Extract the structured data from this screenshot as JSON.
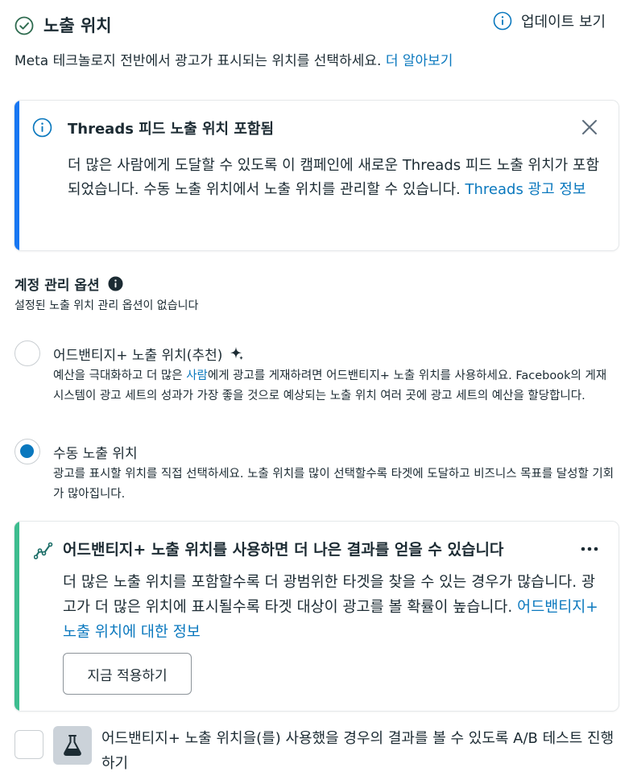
{
  "header": {
    "title": "노출 위치",
    "update_label": "업데이트 보기",
    "description": "Meta 테크놀로지 전반에서 광고가 표시되는 위치를 선택하세요.",
    "learn_more": "더 알아보기"
  },
  "threads_notice": {
    "title": "Threads 피드 노출 위치 포함됨",
    "body": "더 많은 사람에게 도달할 수 있도록 이 캠페인에 새로운 Threads 피드 노출 위치가 포함되었습니다. 수동 노출 위치에서 노출 위치를 관리할 수 있습니다.",
    "link": "Threads 광고 정보",
    "accent_color": "#1877f2"
  },
  "account_options": {
    "title": "계정 관리 옵션",
    "subtitle": "설정된 노출 위치 관리 옵션이 없습니다"
  },
  "placement_options": [
    {
      "label": "어드밴티지+ 노출 위치(추천)",
      "desc_before": "예산을 극대화하고 더 많은 ",
      "desc_link": "사람",
      "desc_after": "에게 광고를 게재하려면 어드밴티지+ 노출 위치를 사용하세요. Facebook의 게재 시스템이 광고 세트의 성과가 가장 좋을 것으로 예상되는 노출 위치 여러 곳에 광고 세트의 예산을 할당합니다.",
      "selected": false
    },
    {
      "label": "수동 노출 위치",
      "desc": "광고를 표시할 위치를 직접 선택하세요. 노출 위치를 많이 선택할수록 타겟에 도달하고 비즈니스 목표를 달성할 기회가 많아집니다.",
      "selected": true
    }
  ],
  "recommendation": {
    "title": "어드밴티지+ 노출 위치를 사용하면 더 나은 결과를 얻을 수 있습니다",
    "body": "더 많은 노출 위치를 포함할수록 더 광범위한 타겟을 찾을 수 있는 경우가 많습니다. 광고가 더 많은 위치에 표시될수록 타겟 대상이 광고를 볼 확률이 높습니다.",
    "link": "어드밴티지+ 노출 위치에 대한 정보",
    "button": "지금 적용하기",
    "accent_color": "#3dbd8f"
  },
  "ab_test": {
    "label": "어드밴티지+ 노출 위치을(를) 사용했을 경우의 결과를 볼 수 있도록 A/B 테스트 진행하기",
    "checked": false
  },
  "colors": {
    "link": "#0a78be",
    "radio_selected": "#0a78be",
    "text": "#1c2b33"
  }
}
